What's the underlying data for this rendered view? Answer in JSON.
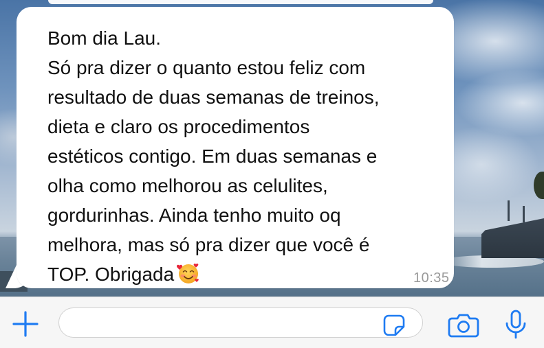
{
  "chat": {
    "message": {
      "text": "Bom dia Lau.\nSó pra dizer o quanto estou feliz com\nresultado de duas semanas de treinos,\ndieta e claro os procedimentos\nestéticos contigo. Em duas semanas e\nolha como melhorou as celulites,\ngordurinhas. Ainda tenho muito oq\nmelhora, mas só pra dizer que você é\nTOP. Obrigada",
      "emoji": "smiling-face-with-hearts",
      "time": "10:35"
    }
  },
  "toolbar": {
    "input_value": "",
    "input_placeholder": "",
    "icons": {
      "add": "plus-icon",
      "sticker": "sticker-icon",
      "camera": "camera-icon",
      "mic": "microphone-icon"
    },
    "accent_color": "#1e7bf2"
  }
}
